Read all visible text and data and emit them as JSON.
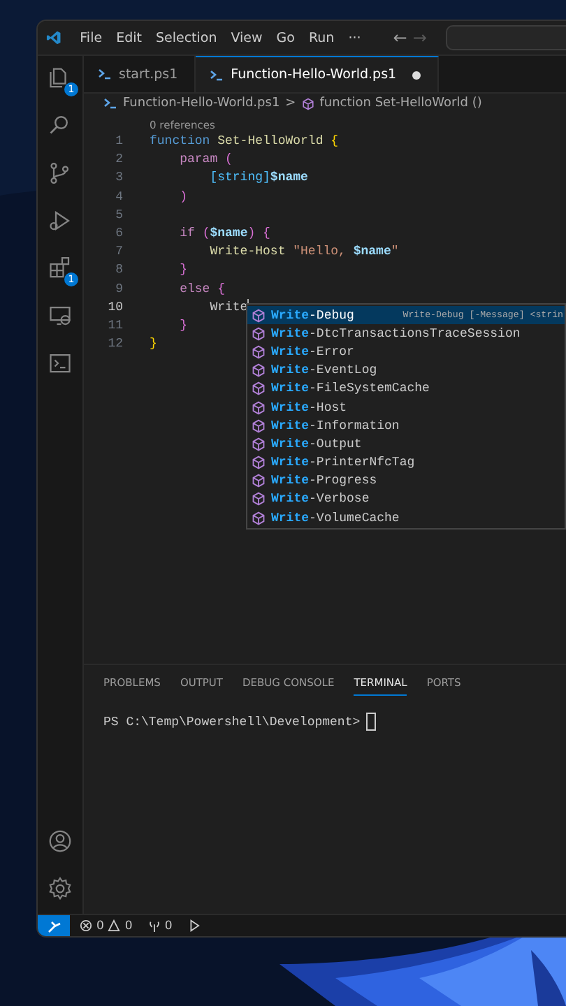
{
  "menu": [
    "File",
    "Edit",
    "Selection",
    "View",
    "Go",
    "Run",
    "···"
  ],
  "navigation": {
    "back": "←",
    "forward": "→"
  },
  "activity_bar": [
    {
      "kind": "explorer",
      "badge": "1"
    },
    {
      "kind": "search"
    },
    {
      "kind": "source-control"
    },
    {
      "kind": "run"
    },
    {
      "kind": "extensions",
      "badge": "1"
    },
    {
      "kind": "remote"
    },
    {
      "kind": "terminal"
    }
  ],
  "activity_bottom": [
    {
      "kind": "account"
    },
    {
      "kind": "settings"
    }
  ],
  "tabs": [
    {
      "label": "start.ps1",
      "selected": false,
      "modified": false
    },
    {
      "label": "Function-Hello-World.ps1",
      "selected": true,
      "modified": true
    }
  ],
  "breadcrumb": {
    "file": "Function-Hello-World.ps1",
    "separator": ">",
    "symbol": "function Set-HelloWorld ()"
  },
  "codelens": "0 references",
  "lines": [
    {
      "number": "1",
      "current": false,
      "tokens": [
        {
          "t": "function ",
          "kind": "keyword"
        },
        {
          "t": "Set-HelloWorld ",
          "kind": "function"
        },
        {
          "t": "{",
          "kind": "bracket"
        }
      ]
    },
    {
      "number": "2",
      "current": false,
      "tokens": [
        {
          "t": "    param ",
          "kind": "control"
        },
        {
          "t": "(",
          "kind": "paren"
        }
      ]
    },
    {
      "number": "3",
      "current": false,
      "tokens": [
        {
          "t": "        [string]",
          "kind": "type"
        },
        {
          "t": "$name",
          "kind": "variable"
        }
      ]
    },
    {
      "number": "4",
      "current": false,
      "tokens": [
        {
          "t": "    )",
          "kind": "paren"
        }
      ]
    },
    {
      "number": "5",
      "current": false
    },
    {
      "number": "6",
      "current": false,
      "tokens": [
        {
          "t": "    if ",
          "kind": "control"
        },
        {
          "t": "(",
          "kind": "paren"
        },
        {
          "t": "$name",
          "kind": "variable"
        },
        {
          "t": ") {",
          "kind": "paren"
        }
      ]
    },
    {
      "number": "7",
      "current": false,
      "tokens": [
        {
          "t": "        Write-Host ",
          "kind": "function"
        },
        {
          "t": "\"Hello, ",
          "kind": "string"
        },
        {
          "t": "$name",
          "kind": "variable"
        },
        {
          "t": "\"",
          "kind": "string"
        }
      ]
    },
    {
      "number": "8",
      "current": false,
      "tokens": [
        {
          "t": "    }",
          "kind": "paren"
        }
      ]
    },
    {
      "number": "9",
      "current": false,
      "tokens": [
        {
          "t": "    else ",
          "kind": "control"
        },
        {
          "t": "{",
          "kind": "paren"
        }
      ]
    },
    {
      "number": "10",
      "current": true,
      "tokens": [
        {
          "t": "        Write",
          "kind": "plain"
        }
      ]
    },
    {
      "number": "11",
      "current": false,
      "tokens": [
        {
          "t": "    }",
          "kind": "paren"
        }
      ]
    },
    {
      "number": "12",
      "current": false,
      "tokens": [
        {
          "t": "}",
          "kind": "bracket"
        }
      ]
    }
  ],
  "suggestions": [
    {
      "match": "Write",
      "rest": "-Debug",
      "selected": true,
      "detail": "Write-Debug [-Message] <strin"
    },
    {
      "match": "Write",
      "rest": "-DtcTransactionsTraceSession",
      "selected": false
    },
    {
      "match": "Write",
      "rest": "-Error",
      "selected": false
    },
    {
      "match": "Write",
      "rest": "-EventLog",
      "selected": false
    },
    {
      "match": "Write",
      "rest": "-FileSystemCache",
      "selected": false
    },
    {
      "match": "Write",
      "rest": "-Host",
      "selected": false
    },
    {
      "match": "Write",
      "rest": "-Information",
      "selected": false
    },
    {
      "match": "Write",
      "rest": "-Output",
      "selected": false
    },
    {
      "match": "Write",
      "rest": "-PrinterNfcTag",
      "selected": false
    },
    {
      "match": "Write",
      "rest": "-Progress",
      "selected": false
    },
    {
      "match": "Write",
      "rest": "-Verbose",
      "selected": false
    },
    {
      "match": "Write",
      "rest": "-VolumeCache",
      "selected": false
    }
  ],
  "panel_tabs": [
    {
      "label": "PROBLEMS",
      "selected": false
    },
    {
      "label": "OUTPUT",
      "selected": false
    },
    {
      "label": "DEBUG CONSOLE",
      "selected": false
    },
    {
      "label": "TERMINAL",
      "selected": true
    },
    {
      "label": "PORTS",
      "selected": false
    }
  ],
  "terminal": {
    "prompt": "PS C:\\Temp\\Powershell\\Development>"
  },
  "status_bar": {
    "errors": "0",
    "warnings": "0",
    "ports": "0"
  }
}
